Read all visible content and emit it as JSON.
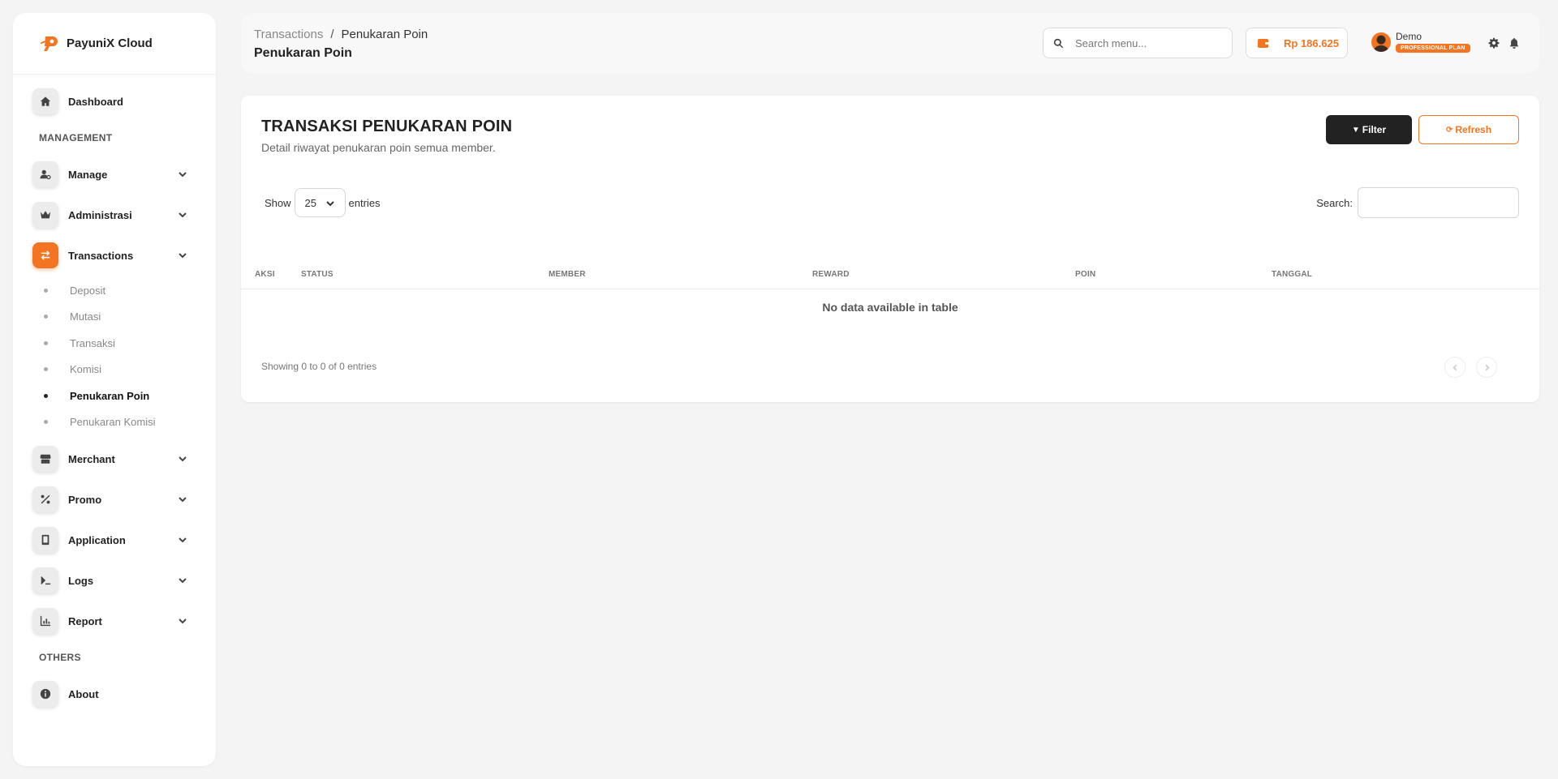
{
  "brand": {
    "name": "PayuniX Cloud",
    "accent": "#f47521"
  },
  "sidebar": {
    "dashboard": "Dashboard",
    "management_title": "MANAGEMENT",
    "items": [
      {
        "label": "Manage",
        "icon": "user-gear-icon"
      },
      {
        "label": "Administrasi",
        "icon": "crown-icon"
      },
      {
        "label": "Transactions",
        "icon": "arrows-exchange-icon"
      }
    ],
    "transactions_sub": [
      {
        "label": "Deposit"
      },
      {
        "label": "Mutasi"
      },
      {
        "label": "Transaksi"
      },
      {
        "label": "Komisi"
      },
      {
        "label": "Penukaran Poin"
      },
      {
        "label": "Penukaran Komisi"
      }
    ],
    "items2": [
      {
        "label": "Merchant",
        "icon": "store-icon"
      },
      {
        "label": "Promo",
        "icon": "percent-icon"
      },
      {
        "label": "Application",
        "icon": "mobile-icon"
      },
      {
        "label": "Logs",
        "icon": "terminal-icon"
      },
      {
        "label": "Report",
        "icon": "chart-bar-icon"
      }
    ],
    "others_title": "OTHERS",
    "about": "About"
  },
  "header": {
    "breadcrumb": [
      "Transactions",
      "/",
      "Penukaran Poin"
    ],
    "title": "Penukaran Poin",
    "search_placeholder": "Search menu...",
    "balance": "Rp 186.625",
    "user_name": "Demo",
    "plan": "PROFESSIONAL PLAN"
  },
  "card": {
    "title": "TRANSAKSI PENUKARAN POIN",
    "subtitle": "Detail riwayat penukaran poin semua member.",
    "filter_label": "Filter",
    "refresh_label": "Refresh",
    "show_label": "Show",
    "entries_value": "25",
    "entries_label": "entries",
    "search_label": "Search:",
    "columns": [
      "AKSI",
      "STATUS",
      "MEMBER",
      "REWARD",
      "POIN",
      "TANGGAL"
    ],
    "empty_text": "No data available in table",
    "info_text": "Showing 0 to 0 of 0 entries"
  }
}
